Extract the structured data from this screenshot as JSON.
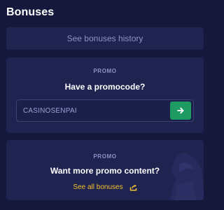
{
  "header": {
    "title": "Bonuses"
  },
  "history": {
    "label": "See bonuses history"
  },
  "promo_card": {
    "eyebrow": "PROMO",
    "heading": "Have a promocode?",
    "input_value": "CASINOSENPAI",
    "submit_icon": "arrow-right-icon"
  },
  "more_card": {
    "eyebrow": "PROMO",
    "heading": "Want more promo content?",
    "link_label": "See all bonuses",
    "link_icon": "external-share-icon",
    "decor_icon": "hooded-figure-icon"
  },
  "colors": {
    "background": "#15183a",
    "card": "#1f2350",
    "accent_green": "#1e9b63",
    "link_yellow": "#f6c32c",
    "muted_text": "#8b93c7"
  }
}
